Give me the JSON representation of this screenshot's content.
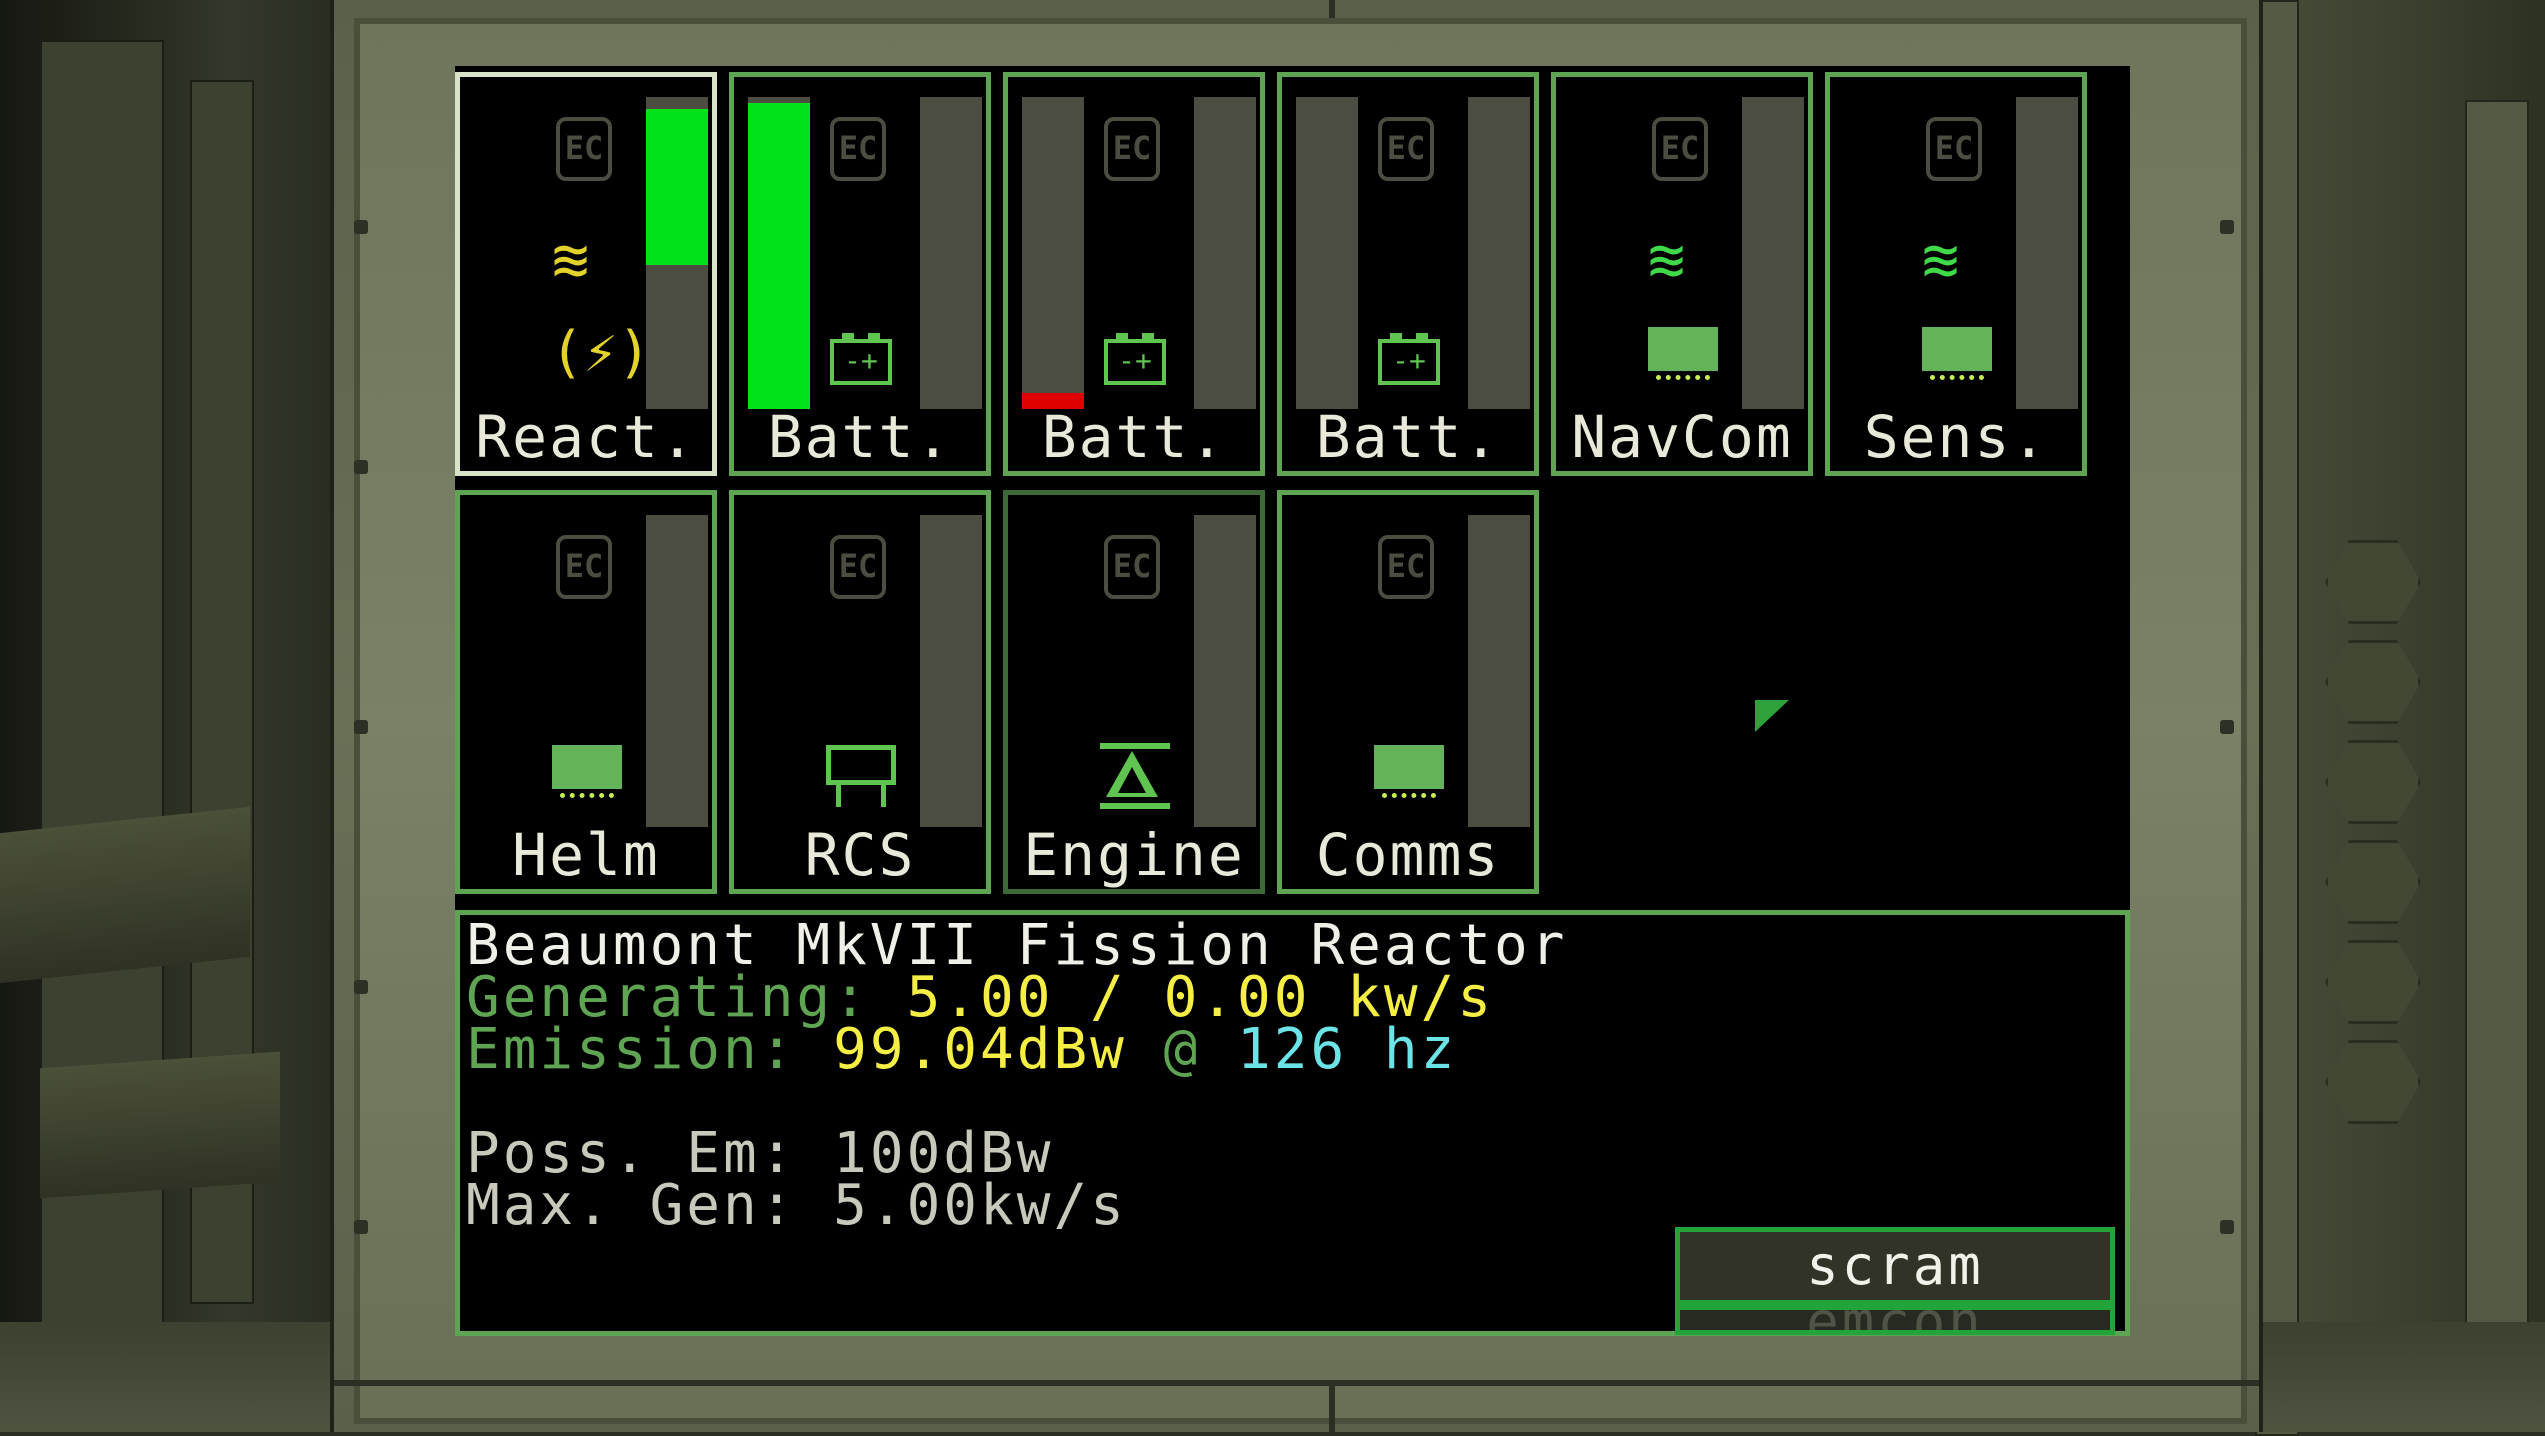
{
  "tiles_row1": [
    {
      "label": "React.",
      "fill": 0.5
    },
    {
      "label": "Batt.",
      "fill": 0.98
    },
    {
      "label": "Batt.",
      "fill": 0.05
    },
    {
      "label": "Batt.",
      "fill": 0
    },
    {
      "label": "NavCom",
      "fill": 0
    },
    {
      "label": "Sens.",
      "fill": 0
    }
  ],
  "tiles_row2": [
    {
      "label": "Helm",
      "fill": 0
    },
    {
      "label": "RCS",
      "fill": 0
    },
    {
      "label": "Engine",
      "fill": 0
    },
    {
      "label": "Comms",
      "fill": 0
    }
  ],
  "icons": {
    "ec": "EC",
    "battery_glyph": "-+",
    "reactor_glyph": "(⚡)",
    "signal_glyph": "≋"
  },
  "colors": {
    "tile_border": "#5fa452",
    "selected_border": "#d7e2c7",
    "bar_green": "#00e21a",
    "bar_red": "#e00000",
    "yellow": "#f5ee44",
    "cyan": "#6ce3e6"
  },
  "info": {
    "title": "Beaumont MkVII Fission Reactor",
    "generating_label": "Generating:",
    "generating_value": "5.00 / 0.00 kw/s",
    "emission_label": "Emission:",
    "emission_value": "99.04dBw",
    "emission_at": "@",
    "emission_freq": "126 hz",
    "possible_emission": "Poss. Em: 100dBw",
    "max_generation": "Max. Gen: 5.00kw/s"
  },
  "buttons": {
    "scram": "scram",
    "emcon": "emcon"
  }
}
